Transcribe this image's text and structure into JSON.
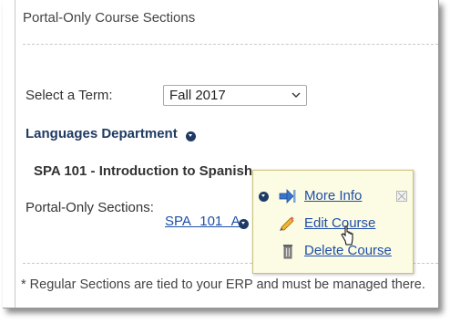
{
  "header": {
    "title": "Portal-Only Course Sections"
  },
  "term": {
    "label": "Select a Term:",
    "selected": "Fall 2017"
  },
  "department": {
    "name": "Languages Department"
  },
  "course": {
    "title": "SPA 101 - Introduction to Spanish"
  },
  "sections": {
    "label": "Portal-Only Sections:",
    "link": "SPA 101 A"
  },
  "popup_menu": {
    "items": [
      {
        "label": "More Info",
        "icon": "more-info-arrow-icon"
      },
      {
        "label": "Edit Course",
        "icon": "pencil-icon"
      },
      {
        "label": "Delete Course",
        "icon": "trash-icon"
      }
    ]
  },
  "footnote": "* Regular Sections are tied to your ERP and must be managed there.",
  "colors": {
    "link": "#1f4fa8",
    "department": "#1f3a64",
    "popup_background": "#fcfbe3"
  }
}
